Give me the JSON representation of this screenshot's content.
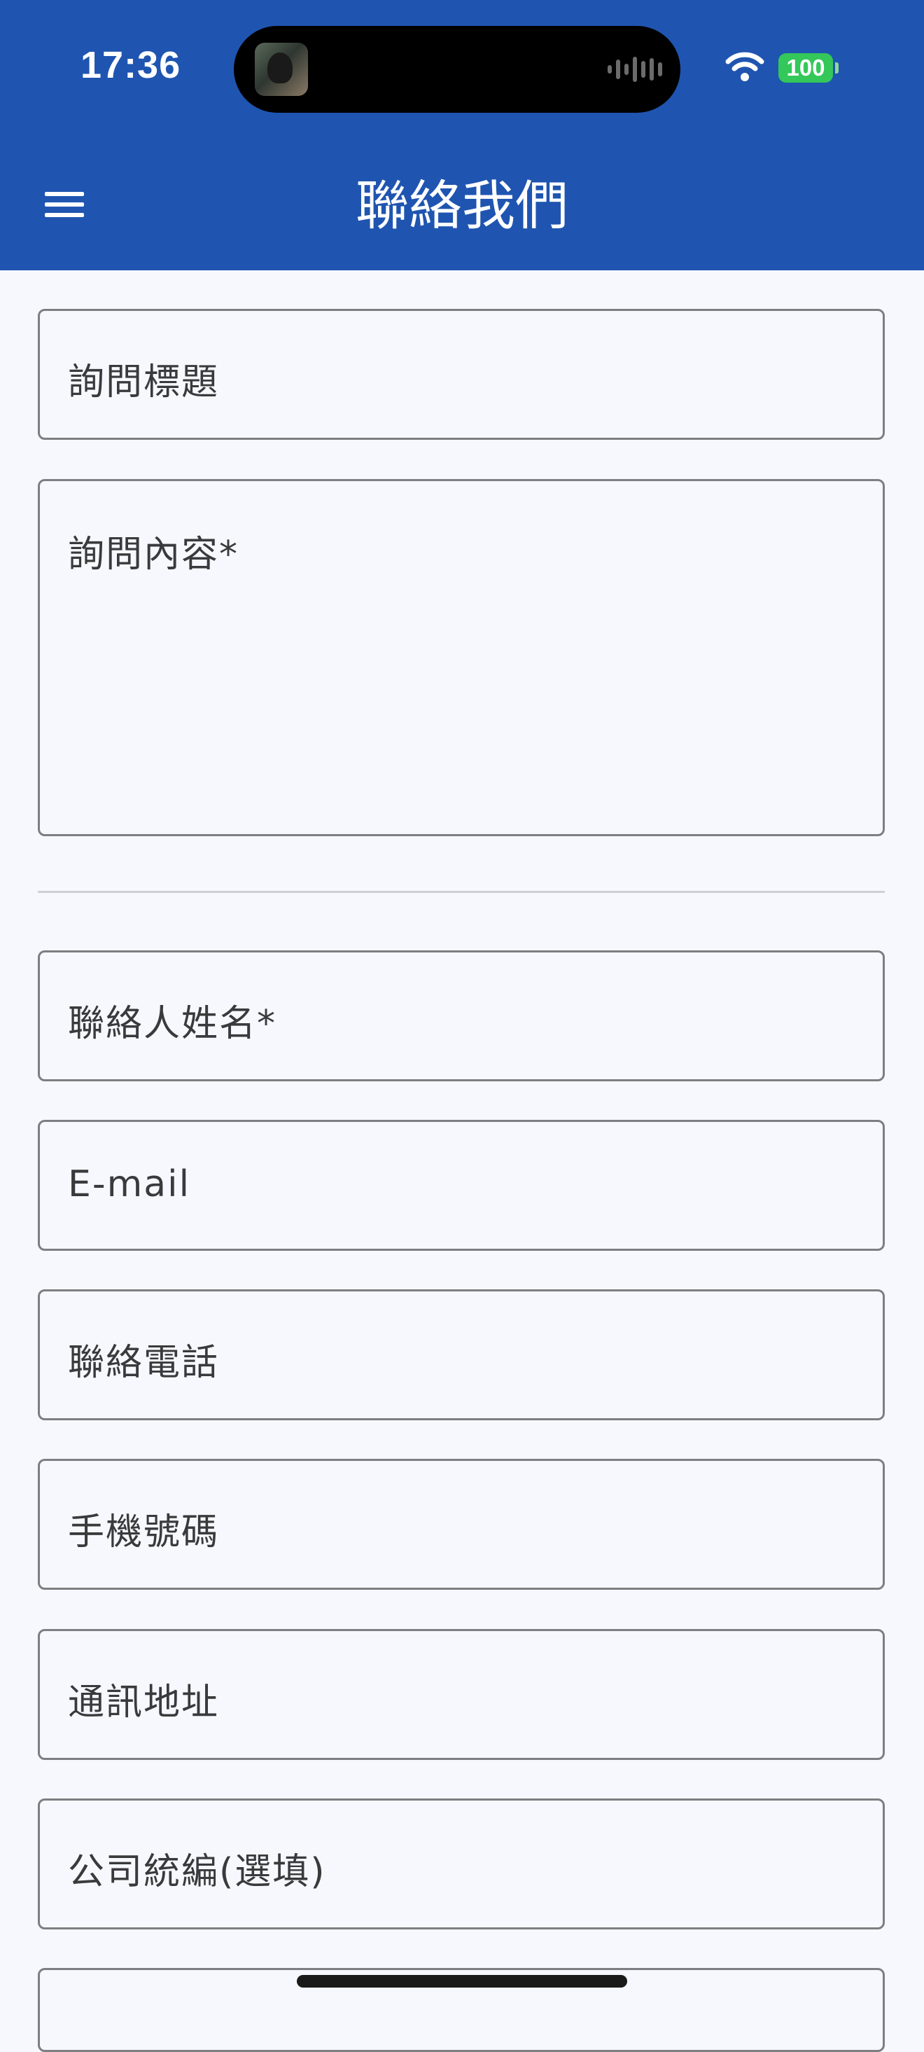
{
  "status_bar": {
    "time": "17:36",
    "battery_level": "100",
    "battery_color": "#34c759"
  },
  "header": {
    "title": "聯絡我們",
    "menu_icon": "hamburger-menu-icon",
    "background_color": "#1f55b0"
  },
  "form": {
    "fields": [
      {
        "label": "詢問標題"
      },
      {
        "label": "詢問內容*"
      },
      {
        "label": "聯絡人姓名*"
      },
      {
        "label": "E-mail"
      },
      {
        "label": "聯絡電話"
      },
      {
        "label": "手機號碼"
      },
      {
        "label": "通訊地址"
      },
      {
        "label": "公司統編(選填)"
      }
    ]
  }
}
